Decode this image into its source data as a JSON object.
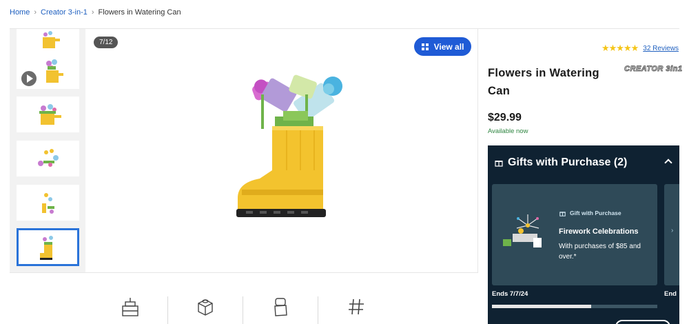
{
  "breadcrumb": {
    "home": "Home",
    "category": "Creator 3-in-1",
    "current": "Flowers in Watering Can"
  },
  "gallery": {
    "counter": "7/12",
    "view_all": "View all",
    "active_thumb_index": 5
  },
  "product": {
    "rating": 5,
    "reviews": "32 Reviews",
    "title": "Flowers in Watering Can",
    "brand": "CREATOR 3in1",
    "price": "$29.99",
    "availability": "Available now"
  },
  "gifts": {
    "header": "Gifts with Purchase (2)",
    "card": {
      "label": "Gift with Purchase",
      "title": "Firework Celebrations",
      "description": "With purchases of $85 and over.*",
      "ends": "Ends 7/7/24",
      "progress": 0.6
    },
    "next_card_ends": "End"
  },
  "features": [
    "age-icon",
    "pieces-icon",
    "minifigure-icon",
    "item-number-icon"
  ],
  "colors": {
    "link": "#1e5fbf",
    "accent_button": "#1f5bd6",
    "gifts_bg": "#0f2232",
    "card_bg": "#2f4a58",
    "available": "#2e8540",
    "star": "#f5c518"
  }
}
